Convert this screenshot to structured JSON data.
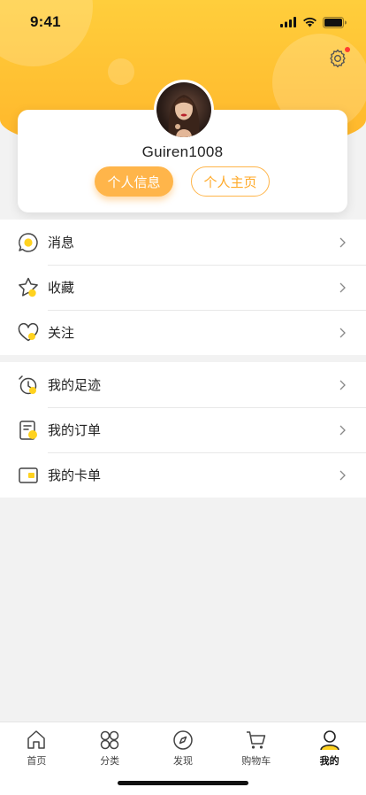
{
  "status_bar": {
    "time": "9:41"
  },
  "profile": {
    "username": "Guiren1008",
    "info_button": "个人信息",
    "homepage_button": "个人主页"
  },
  "menu_group_1": [
    {
      "label": "消息",
      "icon": "message-icon"
    },
    {
      "label": "收藏",
      "icon": "star-icon"
    },
    {
      "label": "关注",
      "icon": "heart-icon"
    }
  ],
  "menu_group_2": [
    {
      "label": "我的足迹",
      "icon": "footprint-icon"
    },
    {
      "label": "我的订单",
      "icon": "order-icon"
    },
    {
      "label": "我的卡单",
      "icon": "card-icon"
    }
  ],
  "tabbar": [
    {
      "label": "首页",
      "icon": "home-icon",
      "active": false
    },
    {
      "label": "分类",
      "icon": "category-icon",
      "active": false
    },
    {
      "label": "发现",
      "icon": "compass-icon",
      "active": false
    },
    {
      "label": "购物车",
      "icon": "cart-icon",
      "active": false
    },
    {
      "label": "我的",
      "icon": "user-icon",
      "active": true
    }
  ],
  "colors": {
    "header_gradient_top": "#ffce3c",
    "header_gradient_bottom": "#ffb52a",
    "accent_orange": "#ffb54a",
    "icon_yellow": "#ffd21f"
  }
}
